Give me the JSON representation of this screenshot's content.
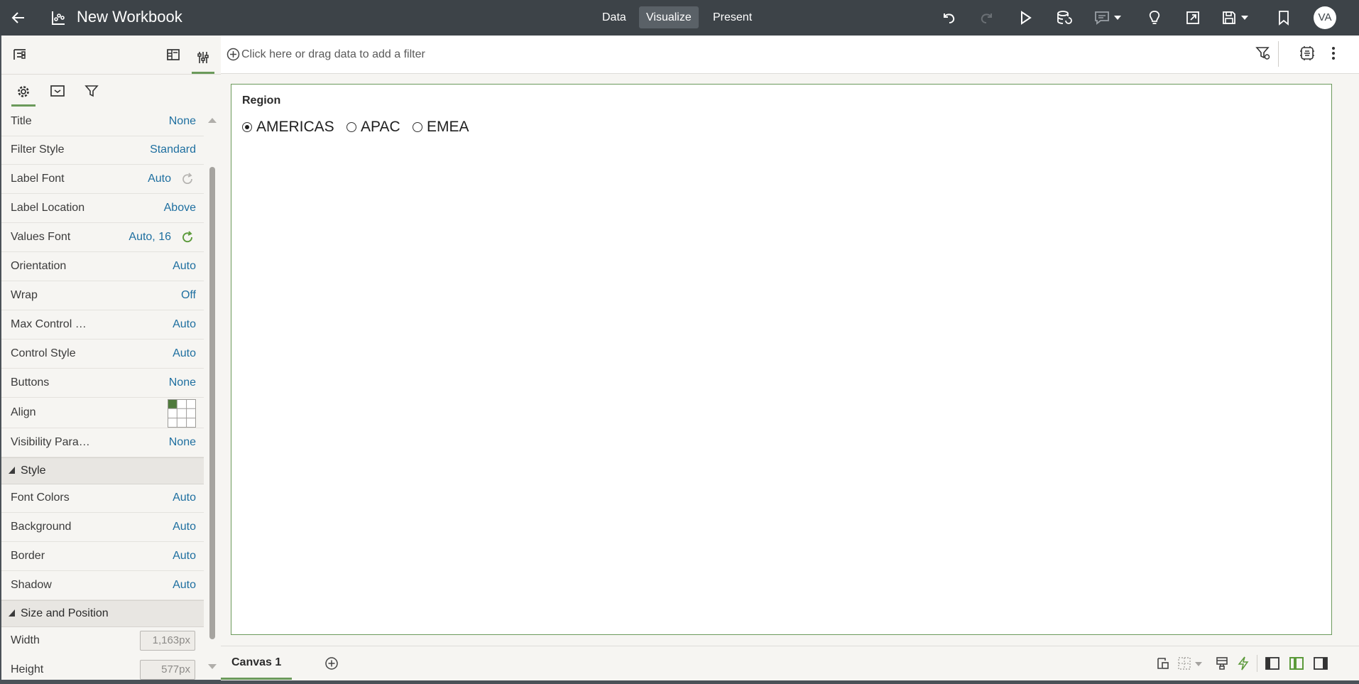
{
  "header": {
    "title": "New Workbook",
    "modes": [
      {
        "label": "Data"
      },
      {
        "label": "Visualize",
        "active": true
      },
      {
        "label": "Present"
      }
    ],
    "avatar_initials": "VA",
    "icons": [
      "back-arrow-icon",
      "workbook-icon",
      "undo-icon",
      "redo-icon",
      "play-icon",
      "data-refresh-icon",
      "comment-icon",
      "lightbulb-icon",
      "export-icon",
      "save-icon",
      "bookmark-icon"
    ]
  },
  "filter_bar": {
    "placeholder": "Click here or drag data to add a filter"
  },
  "properties": {
    "rows": [
      {
        "label": "Title",
        "value": "None"
      },
      {
        "label": "Filter Style",
        "value": "Standard"
      },
      {
        "label": "Label Font",
        "value": "Auto"
      },
      {
        "label": "Label Location",
        "value": "Above"
      },
      {
        "label": "Values Font",
        "value": "Auto, 16"
      },
      {
        "label": "Orientation",
        "value": "Auto"
      },
      {
        "label": "Wrap",
        "value": "Off"
      },
      {
        "label": "Max Control …",
        "value": "Auto"
      },
      {
        "label": "Control Style",
        "value": "Auto"
      },
      {
        "label": "Buttons",
        "value": "None"
      },
      {
        "label": "Align",
        "value": ""
      },
      {
        "label": "Visibility Para…",
        "value": "None"
      }
    ],
    "style_section": {
      "title": "Style",
      "rows": [
        {
          "label": "Font Colors",
          "value": "Auto"
        },
        {
          "label": "Background",
          "value": "Auto"
        },
        {
          "label": "Border",
          "value": "Auto"
        },
        {
          "label": "Shadow",
          "value": "Auto"
        }
      ]
    },
    "size_section": {
      "title": "Size and Position",
      "rows": [
        {
          "label": "Width",
          "value": "1,163px"
        },
        {
          "label": "Height",
          "value": "577px"
        }
      ]
    }
  },
  "visualization": {
    "title": "Region",
    "options": [
      {
        "label": "AMERICAS",
        "selected": true
      },
      {
        "label": "APAC",
        "selected": false
      },
      {
        "label": "EMEA",
        "selected": false
      }
    ]
  },
  "canvas_tabs": [
    {
      "label": "Canvas 1",
      "active": true
    }
  ],
  "colors": {
    "topbar": "#3d4348",
    "accent_green": "#6b9a5b",
    "value_blue": "#1e6fa0"
  }
}
